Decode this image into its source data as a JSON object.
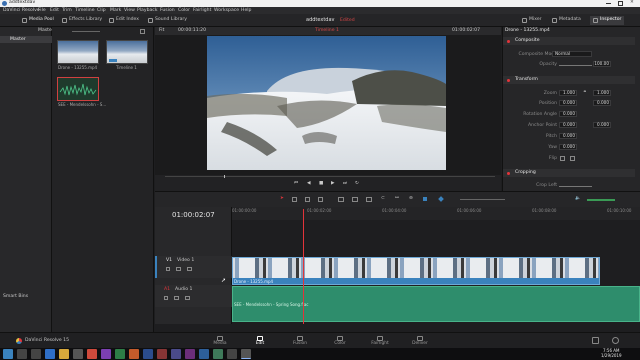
{
  "titlebar": {
    "title": "addtextdav"
  },
  "menu": [
    "DaVinci Resolve",
    "File",
    "Edit",
    "Trim",
    "Timeline",
    "Clip",
    "Mark",
    "View",
    "Playback",
    "Fusion",
    "Color",
    "Fairlight",
    "Workspace",
    "Help"
  ],
  "toolbar": {
    "media_pool": "Media Pool",
    "effects_library": "Effects Library",
    "edit_index": "Edit Index",
    "sound_library": "Sound Library",
    "project_name": "addtextdav",
    "project_status": "Edited",
    "mixer": "Mixer",
    "metadata": "Metadata",
    "inspector": "Inspector"
  },
  "bin_tree": {
    "header": "Master",
    "items": [
      "Master"
    ],
    "smart_bins": "Smart Bins"
  },
  "media_pool": {
    "clips": [
      {
        "name": "Drone - 13255.mp4"
      },
      {
        "name": "Timeline 1"
      },
      {
        "name": "SEE - Mendelssohn - S..."
      }
    ]
  },
  "viewer": {
    "zoom": "Fit",
    "source_tc": "00:00:11:20",
    "timeline_name": "Timeline 1",
    "record_tc": "01:00:02:07"
  },
  "inspector": {
    "clip_title": "Drone - 13255.mp4",
    "sections": {
      "composite": "Composite",
      "transform": "Transform",
      "cropping": "Cropping"
    },
    "composite_mode_label": "Composite Mode",
    "composite_mode_value": "Normal",
    "opacity_label": "Opacity",
    "opacity_value": "100.00",
    "zoom_label": "Zoom",
    "zoom_x": "1.000",
    "zoom_y": "1.000",
    "position_label": "Position",
    "position_x": "0.000",
    "position_y": "0.000",
    "rotation_label": "Rotation Angle",
    "rotation_value": "0.000",
    "anchor_label": "Anchor Point",
    "anchor_x": "0.000",
    "anchor_y": "0.000",
    "pitch_label": "Pitch",
    "pitch_value": "0.000",
    "yaw_label": "Yaw",
    "yaw_value": "0.000",
    "flip_label": "Flip",
    "crop_left_label": "Crop Left"
  },
  "timeline": {
    "timecode": "01:00:02:07",
    "ruler_marks": [
      "01:00:00:00",
      "01:00:02:00",
      "01:00:04:00",
      "01:00:06:00",
      "01:00:08:00",
      "01:00:10:00"
    ],
    "playhead_fraction": 0.173,
    "video_track": {
      "id": "V1",
      "name": "Video 1",
      "clip": "Drone - 13255.mp4"
    },
    "audio_track": {
      "id": "A1",
      "name": "Audio 1",
      "clip": "SEE - Mendelssohn - Spring Song.flac"
    }
  },
  "pages": [
    "Media",
    "Edit",
    "Fusion",
    "Color",
    "Fairlight",
    "Deliver"
  ],
  "active_page": "Edit",
  "app_name": "DaVinci Resolve 15",
  "taskbar": {
    "time": "7:56 AM",
    "date": "1/29/2019"
  },
  "colors": {
    "accent": "#e2343a",
    "video_clip": "#3a82bd",
    "audio_clip": "#2e8d6c",
    "panel": "#262628"
  }
}
